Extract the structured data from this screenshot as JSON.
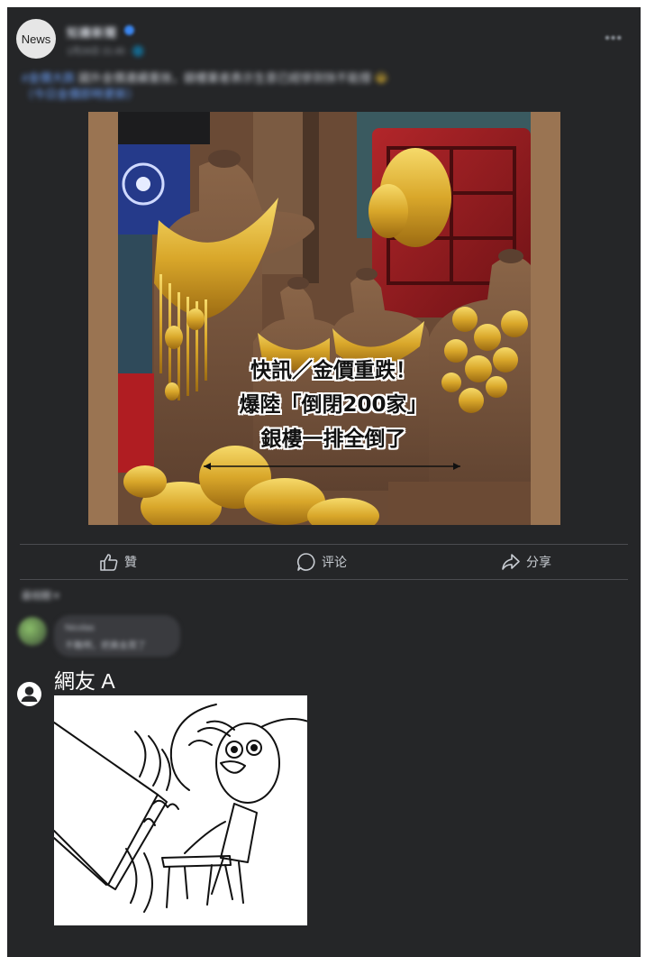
{
  "post": {
    "avatar_label": "News",
    "page_name": "知識新聞",
    "post_time": "1月26日 21:45 · 🌐",
    "more_icon": "ellipsis-icon",
    "caption_link": "#金價大跌",
    "caption_text": "國外金價連續重挫，銀樓業者表示生意已經慘到快不能撐",
    "caption_emoji": "😭",
    "caption_link2": "（今日金價即時更新）"
  },
  "photo": {
    "headline_line1": "快訊／金價重跌！",
    "headline_line2": "爆陸「倒閉200家」",
    "headline_line3": "銀樓一排全倒了"
  },
  "actions": {
    "like": "贊",
    "comment": "评论",
    "share": "分享"
  },
  "comments": {
    "sort_label": "最相關 ▾",
    "blurred_name": "Nicolas",
    "blurred_text": "不難啊，把黃金買了",
    "netizen_name": "網友 A"
  },
  "colors": {
    "background": "#252628",
    "text_muted": "#c8ccd2",
    "accent": "#3b86f0"
  }
}
